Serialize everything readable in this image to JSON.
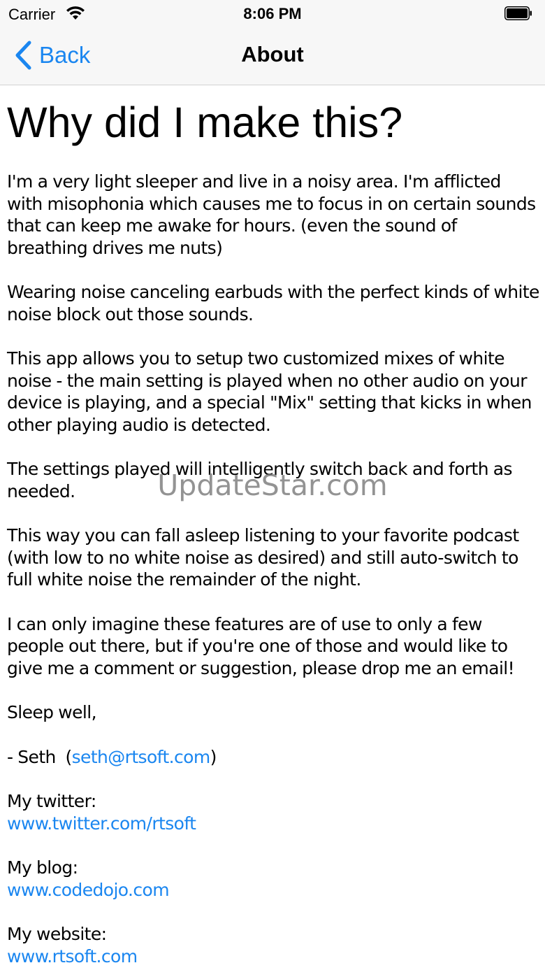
{
  "status_bar": {
    "carrier": "Carrier",
    "time": "8:06 PM",
    "wifi_icon": "wifi-icon",
    "battery_icon": "battery-icon"
  },
  "nav": {
    "back_label": "Back",
    "back_icon": "chevron-left-icon",
    "title": "About",
    "accent_color": "#1a86f0"
  },
  "content": {
    "heading": "Why did I make this?",
    "paragraphs": [
      "I'm a very light sleeper and live in a noisy area. I'm afflicted with misophonia which causes me to focus in on certain sounds that can keep me awake for hours. (even the sound of breathing drives me nuts)",
      "Wearing noise canceling earbuds with the perfect kinds of white noise block out those sounds.",
      "This app allows you to setup two customized mixes of white noise - the main setting is played when no other audio on your device is playing, and a special \"Mix\" setting that kicks in when other playing audio is detected.",
      "The settings played will intelligently switch back and forth as needed.",
      "This way you can fall asleep listening to your favorite podcast (with low to no white noise as desired) and still auto-switch to full white noise the remainder of the night.",
      "I can only imagine these features are of use to only a few people out there, but if you're one of those and would like to give me a comment or suggestion, please drop me an email!",
      "Sleep well,"
    ],
    "signature": {
      "prefix": "- Seth  (",
      "email": "seth@rtsoft.com",
      "suffix": ")"
    },
    "twitter": {
      "label": "My twitter:",
      "link": "www.twitter.com/rtsoft"
    },
    "blog": {
      "label": "My blog:",
      "link": "www.codedojo.com"
    },
    "website": {
      "label": "My website:",
      "link": "www.rtsoft.com"
    }
  },
  "watermark": "UpdateStar.com"
}
